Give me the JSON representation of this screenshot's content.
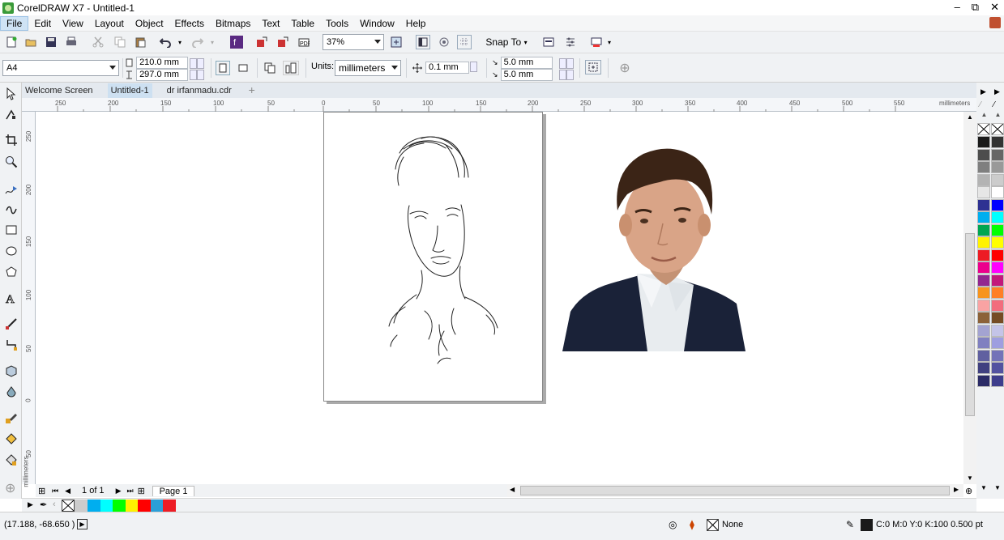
{
  "window": {
    "title": "CorelDRAW X7 - Untitled-1",
    "minimize": "–",
    "restore": "⧉",
    "close": "✕"
  },
  "menu": [
    "File",
    "Edit",
    "View",
    "Layout",
    "Object",
    "Effects",
    "Bitmaps",
    "Text",
    "Table",
    "Tools",
    "Window",
    "Help"
  ],
  "toolbar": {
    "zoom": "37%",
    "snap_to": "Snap To"
  },
  "property_bar": {
    "paper_size": "A4",
    "width": "210.0 mm",
    "height": "297.0 mm",
    "units_label": "Units:",
    "units": "millimeters",
    "nudge": "0.1 mm",
    "dup_x": "5.0 mm",
    "dup_y": "5.0 mm"
  },
  "tabs": [
    "Welcome Screen",
    "Untitled-1",
    "dr irfanmadu.cdr"
  ],
  "ruler": {
    "h_labels": [
      "250",
      "200",
      "150",
      "100",
      "50",
      "0",
      "50",
      "100",
      "150",
      "200",
      "250",
      "300",
      "350",
      "400",
      "450",
      "500",
      "550"
    ],
    "h_unit": "millimeters",
    "v_labels": [
      "250",
      "200",
      "150",
      "100",
      "50",
      "0",
      "50"
    ],
    "v_unit": "millimeters"
  },
  "page_nav": {
    "counter": "1 of 1",
    "page_tab": "Page 1"
  },
  "status": {
    "coords": "(17.188, -68.650 )",
    "fill": "None",
    "outline": "C:0 M:0 Y:0 K:100  0.500 pt"
  },
  "palette_colors": [
    "#1a1a1a",
    "#333333",
    "#4d4d4d",
    "#666666",
    "#7f7f7f",
    "#999999",
    "#b3b3b3",
    "#cccccc",
    "#e6e6e6",
    "#ffffff",
    "#2e3192",
    "#0000ff",
    "#00aeef",
    "#00ffff",
    "#00a651",
    "#00ff00",
    "#fff200",
    "#ffff00",
    "#ed1c24",
    "#ff0000",
    "#ec008c",
    "#ff00ff",
    "#92278f",
    "#c2187b",
    "#f7941d",
    "#ff7f27",
    "#f9a3a3",
    "#f26d7d",
    "#8c6239",
    "#754c24",
    "#a3a3d1",
    "#c4c4e8",
    "#8080c0",
    "#9e9ee0",
    "#6060a0",
    "#7373b8",
    "#404080",
    "#5252a0",
    "#2b2b66",
    "#3d3d8c"
  ],
  "doc_palette_colors": [
    "#00aeef",
    "#00ffff",
    "#00ff00",
    "#fff200",
    "#ff0000",
    "#2b9fd8",
    "#ed1c24"
  ]
}
